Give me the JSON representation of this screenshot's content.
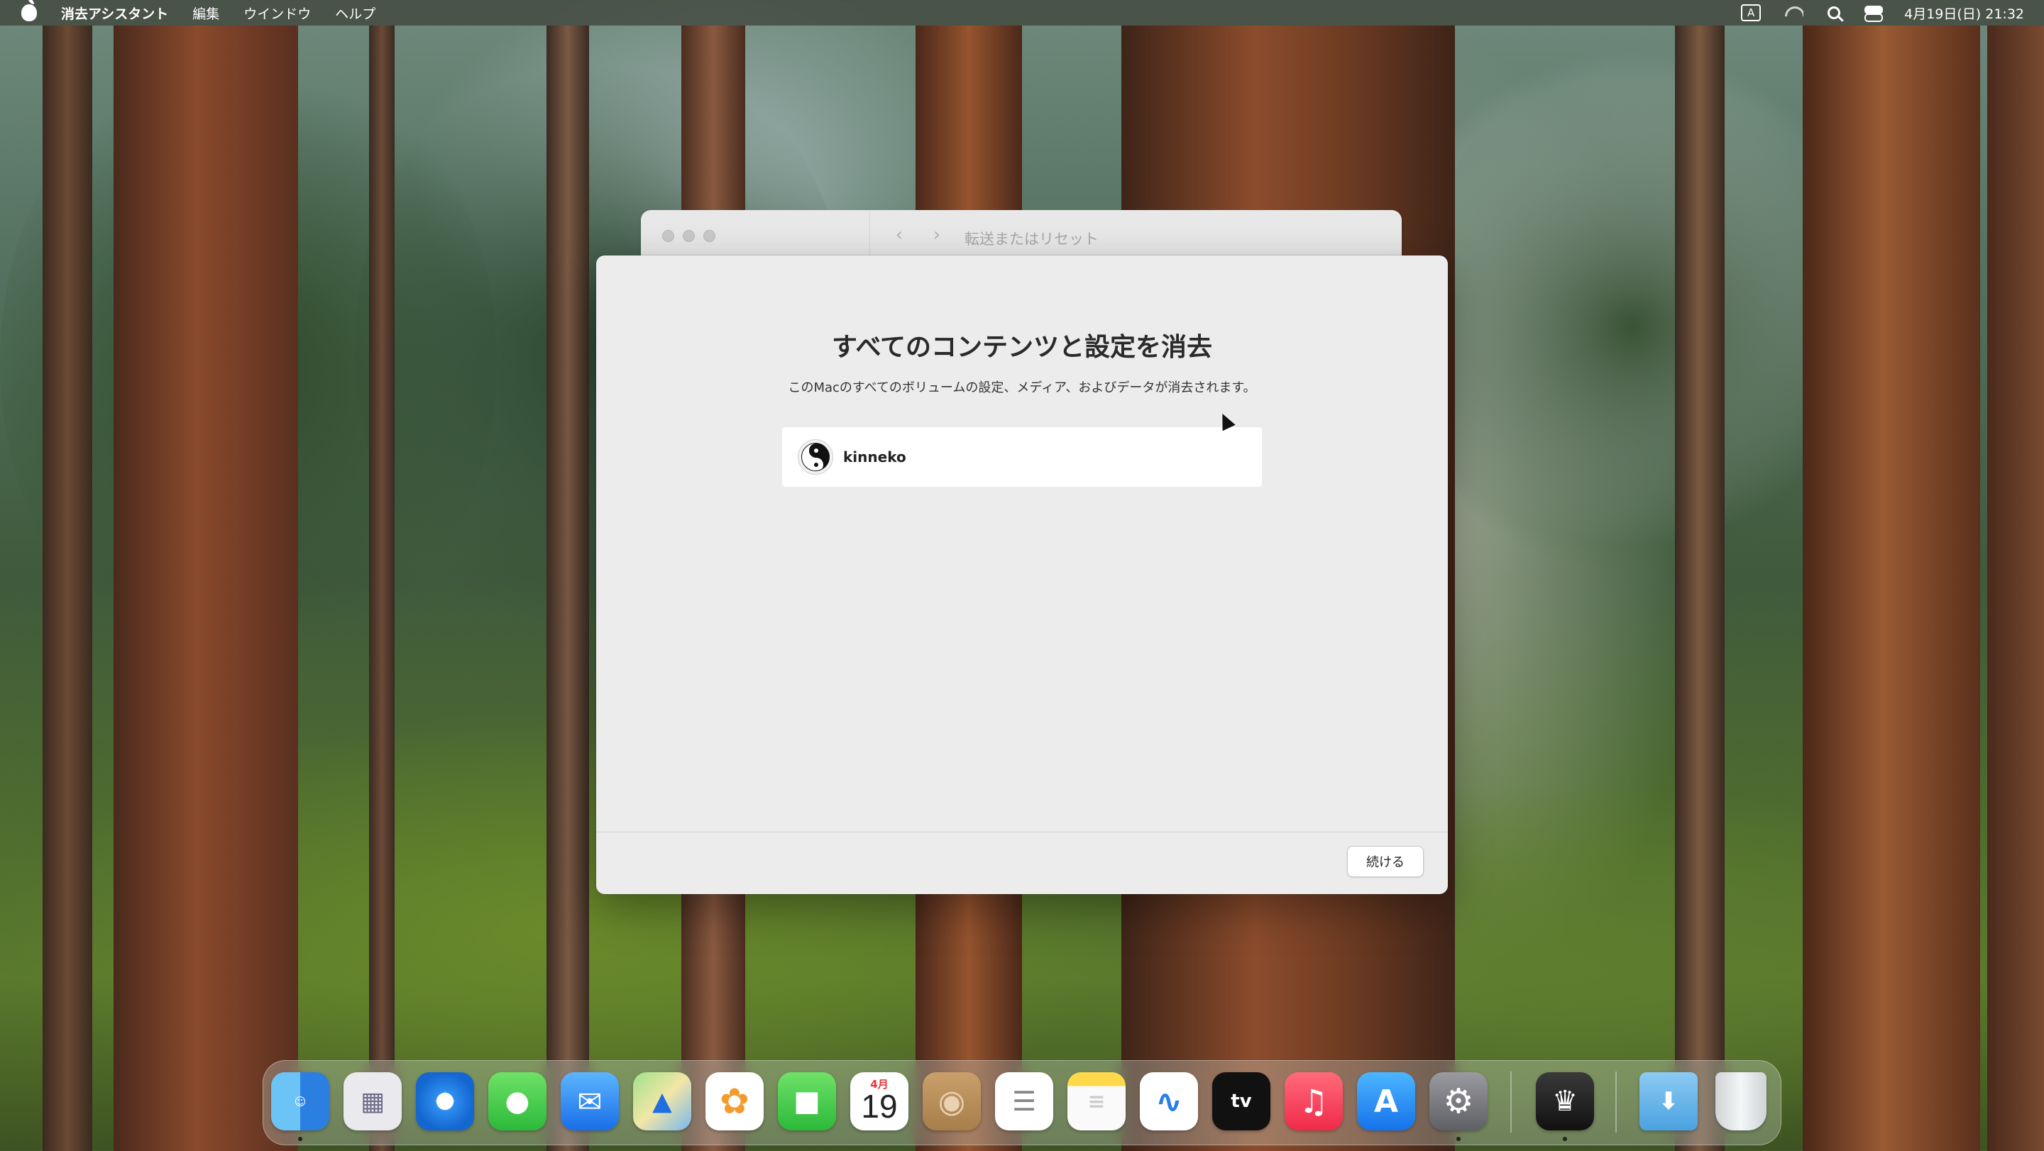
{
  "menubar": {
    "app_name": "消去アシスタント",
    "items": [
      "編集",
      "ウインドウ",
      "ヘルプ"
    ],
    "input_mode": "A",
    "clock": "4月19日(日) 21:32"
  },
  "window": {
    "title": "転送またはリセット",
    "heading": "すべてのコンテンツと設定を消去",
    "description": "このMacのすべてのボリュームの設定、メディア、およびデータが消去されます。",
    "user": {
      "name": "kinneko"
    },
    "continue_label": "続ける"
  },
  "dock": {
    "icons": [
      "finder-icon",
      "launchpad-icon",
      "safari-icon",
      "messages-icon",
      "mail-icon",
      "maps-icon",
      "photos-icon",
      "facetime-icon",
      "calendar-icon",
      "contacts-icon",
      "reminders-icon",
      "notes-icon",
      "freeform-icon",
      "apple-tv-icon",
      "music-icon",
      "app-store-icon",
      "system-settings-icon",
      "bartender-icon",
      "downloads-folder-icon",
      "trash-icon"
    ],
    "calendar_month": "4月",
    "calendar_day": "19",
    "tv_label": "tv"
  }
}
